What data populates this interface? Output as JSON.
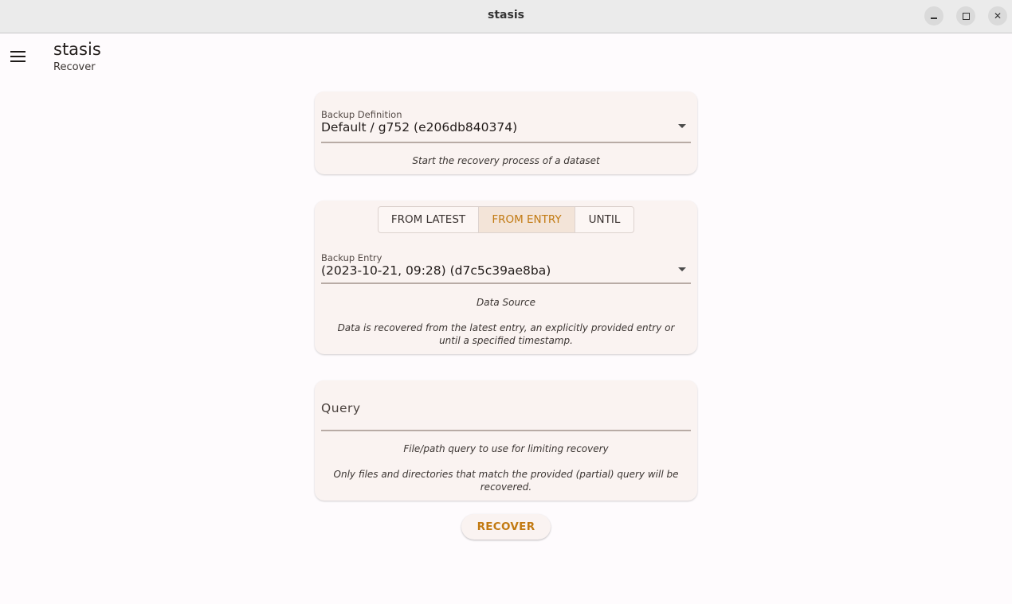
{
  "window": {
    "title": "stasis",
    "controls": {
      "minimize_icon": "minimize-icon",
      "maximize_icon": "maximize-icon",
      "close_icon": "close-icon",
      "close_glyph": "✕"
    }
  },
  "appbar": {
    "menu_icon": "hamburger-menu-icon",
    "title": "stasis",
    "subtitle": "Recover"
  },
  "definition_card": {
    "field_label": "Backup Definition",
    "field_value": "Default / g752 (e206db840374)",
    "helper": "Start the recovery process of a dataset"
  },
  "source_card": {
    "options": [
      {
        "label": "FROM LATEST",
        "selected": false
      },
      {
        "label": "FROM ENTRY",
        "selected": true
      },
      {
        "label": "UNTIL",
        "selected": false
      }
    ],
    "field_label": "Backup Entry",
    "field_value": "(2023-10-21, 09:28) (d7c5c39ae8ba)",
    "helper_title": "Data Source",
    "helper_text": "Data is recovered from the latest entry, an explicitly provided entry or until a specified timestamp."
  },
  "query_card": {
    "placeholder": "Query",
    "value": "",
    "helper_title": "File/path query to use for limiting recovery",
    "helper_text": "Only files and directories that match the provided (partial) query will be recovered."
  },
  "actions": {
    "recover_label": "RECOVER"
  },
  "colors": {
    "accent": "#c27a12",
    "card_background": "#faf3f1",
    "selected_segment": "#f3e4d8",
    "page_background": "#fefbfd"
  }
}
